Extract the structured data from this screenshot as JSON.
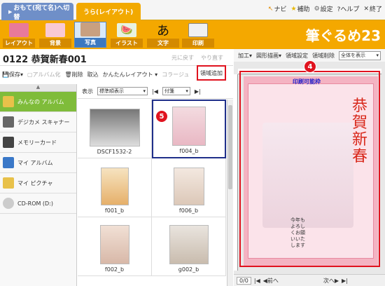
{
  "tabs": {
    "front": "おもて(宛て名)へ切替",
    "back": "うら(レイアウト)"
  },
  "top_links": {
    "navi": "ナビ",
    "hojo": "補助",
    "settings": "設定",
    "help": "?ヘルプ",
    "exit": "終了"
  },
  "toolbar": {
    "layout": "レイアウト",
    "background": "背景",
    "photo": "写真",
    "illust": "イラスト",
    "text": "文字",
    "print": "印刷",
    "brand": "筆ぐるめ23"
  },
  "project": {
    "title": "0122 恭賀新春001",
    "undo": "元に戻す",
    "redo": "やり直す"
  },
  "commands": {
    "save": "保存",
    "album": "アルバム化",
    "delete": "削除",
    "import": "取込",
    "easy_layout": "かんたんレイアウト",
    "collage": "コラージュ",
    "area_add": "領域追加"
  },
  "right_commands": {
    "edit": "加工",
    "shape": "図形描画",
    "area_set": "領域設定",
    "area_delete": "領域削除",
    "zoom": "全体を表示"
  },
  "categories": [
    {
      "label": "みんなの\nアルバム"
    },
    {
      "label": "デジカメ\nスキャナー"
    },
    {
      "label": "メモリーカード"
    },
    {
      "label": "マイ アルバム"
    },
    {
      "label": "マイ ピクチャ"
    },
    {
      "label": "CD-ROM\n(D:)"
    }
  ],
  "thumb_head": {
    "display": "表示",
    "order": "標準順表示",
    "tag": "付箋"
  },
  "thumbs": [
    {
      "name": "DSCF1532-2"
    },
    {
      "name": "f004_b"
    },
    {
      "name": "f001_b"
    },
    {
      "name": "f006_b"
    },
    {
      "name": "f002_b"
    },
    {
      "name": "g002_b"
    }
  ],
  "canvas": {
    "print_label": "印刷可能枠",
    "kanji": "恭賀新春",
    "message": "今年もよろしくお願いいたします"
  },
  "pager": {
    "page": "0/0",
    "prev": "前へ",
    "next": "次へ"
  },
  "badges": {
    "five": "5",
    "four": "4"
  },
  "colors": {
    "accent": "#f4a800",
    "highlight": "#e0131f",
    "active_cat": "#7fbc3a"
  }
}
